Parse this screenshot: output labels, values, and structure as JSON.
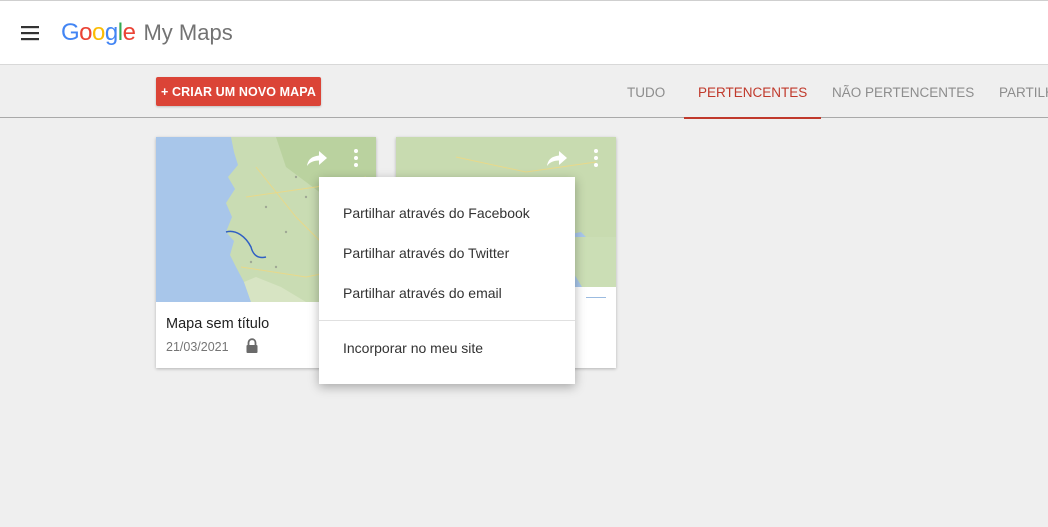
{
  "header": {
    "brand": {
      "letters": [
        "G",
        "o",
        "o",
        "g",
        "l",
        "e"
      ],
      "colors": [
        "#4285f4",
        "#ea4335",
        "#fbbc05",
        "#4285f4",
        "#34a853",
        "#ea4335"
      ]
    },
    "app_name": "My Maps",
    "menu_icon": "hamburger-menu-icon"
  },
  "toolbar": {
    "create_label": "+ CRIAR UM NOVO MAPA",
    "create_color": "#db4437",
    "tabs": [
      {
        "label": "TUDO",
        "active": false
      },
      {
        "label": "PERTENCENTES",
        "active": true
      },
      {
        "label": "NÃO PERTENCENTES",
        "active": false
      },
      {
        "label": "PARTILH",
        "active": false
      }
    ],
    "active_color": "#c0392b"
  },
  "cards": [
    {
      "title": "Mapa sem título",
      "date": "21/03/2021",
      "icons": [
        "share-icon",
        "more-vert-icon",
        "lock-icon"
      ]
    },
    {
      "title": "",
      "date": "",
      "icons": [
        "share-icon",
        "more-vert-icon"
      ]
    }
  ],
  "share_menu": {
    "items": [
      "Partilhar através do Facebook",
      "Partilhar através do Twitter",
      "Partilhar através do email"
    ],
    "embed": "Incorporar no meu site"
  }
}
